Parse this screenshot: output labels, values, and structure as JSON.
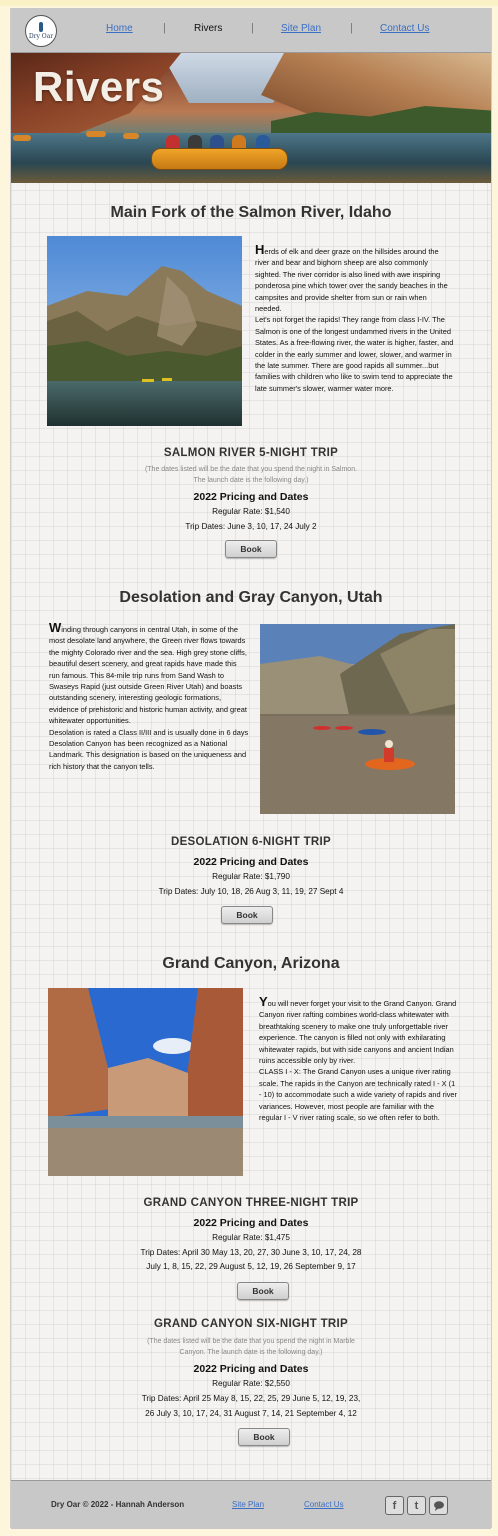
{
  "nav": {
    "logo_text": "Dry Oar",
    "items": [
      {
        "label": "Home"
      },
      {
        "label": "Rivers"
      },
      {
        "label": "Site Plan"
      },
      {
        "label": "Contact Us"
      }
    ],
    "separator": "|"
  },
  "hero": {
    "title": "Rivers"
  },
  "salmon": {
    "title": "Main Fork of the Salmon River, Idaho",
    "dropcap": "H",
    "p1": "erds of elk and deer graze on the hillsides around the river and bear and bighorn sheep are also commonly sighted. The river corridor is also lined with awe inspiring ponderosa pine which tower over the sandy beaches in the campsites and provide shelter from sun or rain when needed.",
    "p2": "Let's not forget the rapids! They range from class I-IV. The Salmon is one of the longest undammed rivers in the United States. As a free-flowing river, the water is higher, faster, and colder in the early summer and lower, slower, and warmer in the late summer. There are good rapids all summer...but families with children who like to swim tend to appreciate the late summer's slower, warmer water more.",
    "trip": {
      "title": "SALMON RIVER 5-NIGHT TRIP",
      "note": "(The dates listed will be the date that you spend the night in Salmon. The launch date is the following day.)",
      "pricing": "2022 Pricing and Dates",
      "rate": "Regular Rate: $1,540",
      "dates": "Trip Dates: June 3, 10, 17, 24 July 2",
      "book": "Book"
    }
  },
  "desolation": {
    "title": "Desolation and Gray Canyon, Utah",
    "dropcap": "W",
    "p1": "inding through canyons in central Utah, in some of the most desolate land anywhere, the Green river flows towards the mighty Colorado river and the sea. High grey stone cliffs, beautiful desert scenery, and great rapids have made this run famous. This 84-mile trip runs from Sand Wash to Swaseys Rapid (just outside Green River Utah) and boasts outstanding scenery, interesting geologic formations, evidence of prehistoric and historic human activity, and great whitewater opportunities.",
    "p2": "Desolation is rated a Class II/III and is usually done in 6 days",
    "p3": "Desolation Canyon has been recognized as a National Landmark. This designation is based on the uniqueness and rich history that the canyon tells.",
    "trip": {
      "title": "DESOLATION 6-NIGHT TRIP",
      "pricing": "2022 Pricing and Dates",
      "rate": "Regular Rate: $1,790",
      "dates": "Trip Dates: July 10, 18, 26 Aug 3, 11, 19, 27 Sept 4",
      "book": "Book"
    }
  },
  "grand": {
    "title": "Grand Canyon, Arizona",
    "dropcap": "Y",
    "p1": "ou will never forget your visit to the Grand Canyon. Grand Canyon river rafting combines world-class whitewater with breathtaking scenery to make one truly unforgettable river experience. The canyon is filled not only with exhilarating whitewater rapids, but with side canyons and ancient Indian ruins accessible only by river.",
    "p2": "CLASS I - X: The Grand Canyon uses a unique river rating scale. The rapids in the Canyon are technically rated I - X (1 - 10) to accommodate such a wide variety of rapids and river variances. However, most people are familiar with the regular I - V river rating scale, so we often refer to both.",
    "trip3": {
      "title": "GRAND CANYON THREE-NIGHT TRIP",
      "pricing": "2022 Pricing and Dates",
      "rate": "Regular Rate: $1,475",
      "dates1": "Trip Dates: April 30 May 13, 20, 27, 30 June 3, 10, 17, 24, 28",
      "dates2": "July 1, 8, 15, 22, 29 August 5, 12, 19, 26 September 9, 17",
      "book": "Book"
    },
    "trip6": {
      "title": "GRAND CANYON SIX-NIGHT TRIP",
      "note": "(The dates listed will be the date that you spend the night in Marble Canyon. The launch date is the following day.)",
      "pricing": "2022 Pricing and Dates",
      "rate": "Regular Rate: $2,550",
      "dates1": "Trip Dates: April 25 May 8, 15, 22, 25, 29 June 5, 12, 19, 23,",
      "dates2": "26 July 3, 10, 17, 24, 31 August 7, 14, 21 September 4, 12",
      "book": "Book"
    }
  },
  "footer": {
    "copyright": "Dry Oar © 2022 - Hannah Anderson",
    "site_plan": "Site Plan",
    "contact": "Contact Us",
    "social": [
      "facebook-icon",
      "twitter-icon",
      "chat-icon"
    ]
  }
}
